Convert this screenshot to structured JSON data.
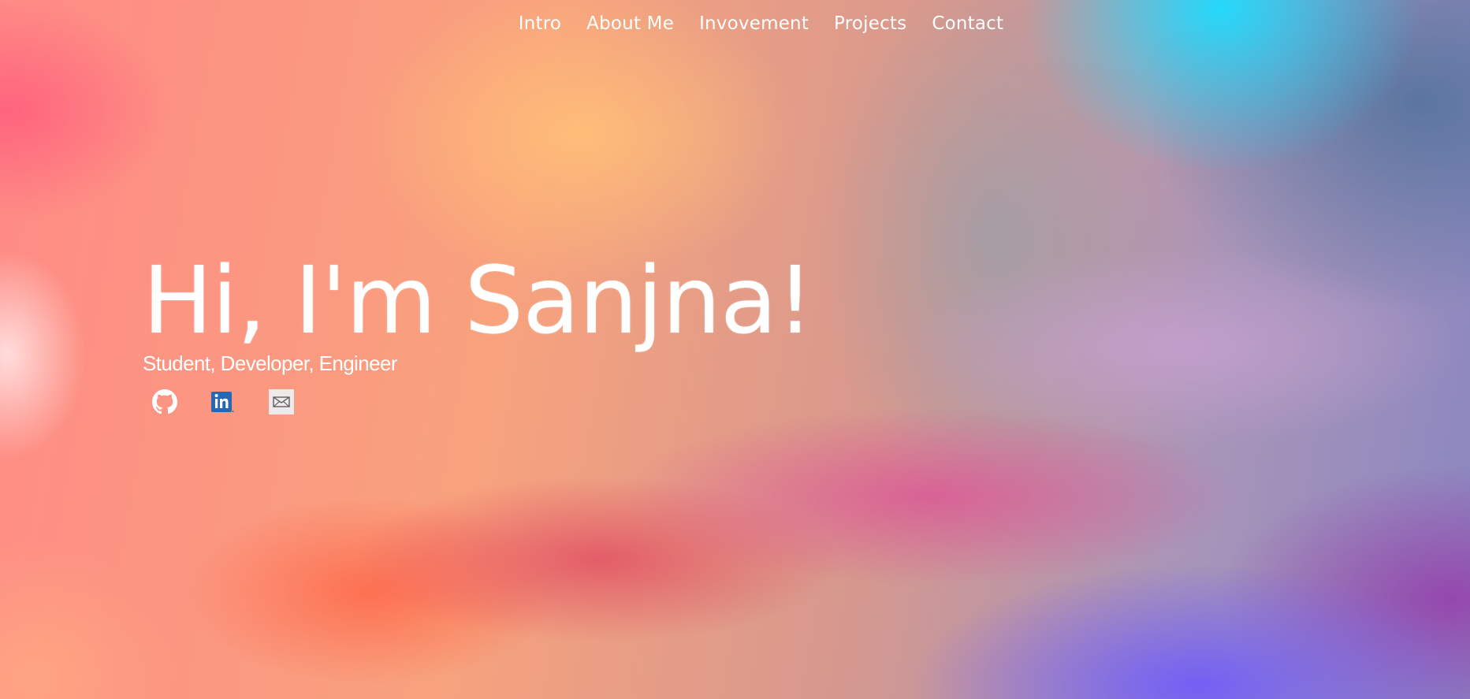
{
  "nav": {
    "items": [
      {
        "label": "Intro"
      },
      {
        "label": "About Me"
      },
      {
        "label": "Invovement"
      },
      {
        "label": "Projects"
      },
      {
        "label": "Contact"
      }
    ]
  },
  "hero": {
    "title": "Hi, I'm Sanjna!",
    "subtitle": "Student, Developer, Engineer"
  },
  "socials": [
    {
      "icon": "github-icon"
    },
    {
      "icon": "linkedin-icon",
      "color": "#2867b2"
    },
    {
      "icon": "mail-icon"
    }
  ],
  "colors": {
    "text": "#ffffff",
    "cyan": "#1edcff",
    "orange": "#ffbe78",
    "pink": "#ff5f7d",
    "magenta": "#dc5096",
    "purple": "#735ff5"
  }
}
